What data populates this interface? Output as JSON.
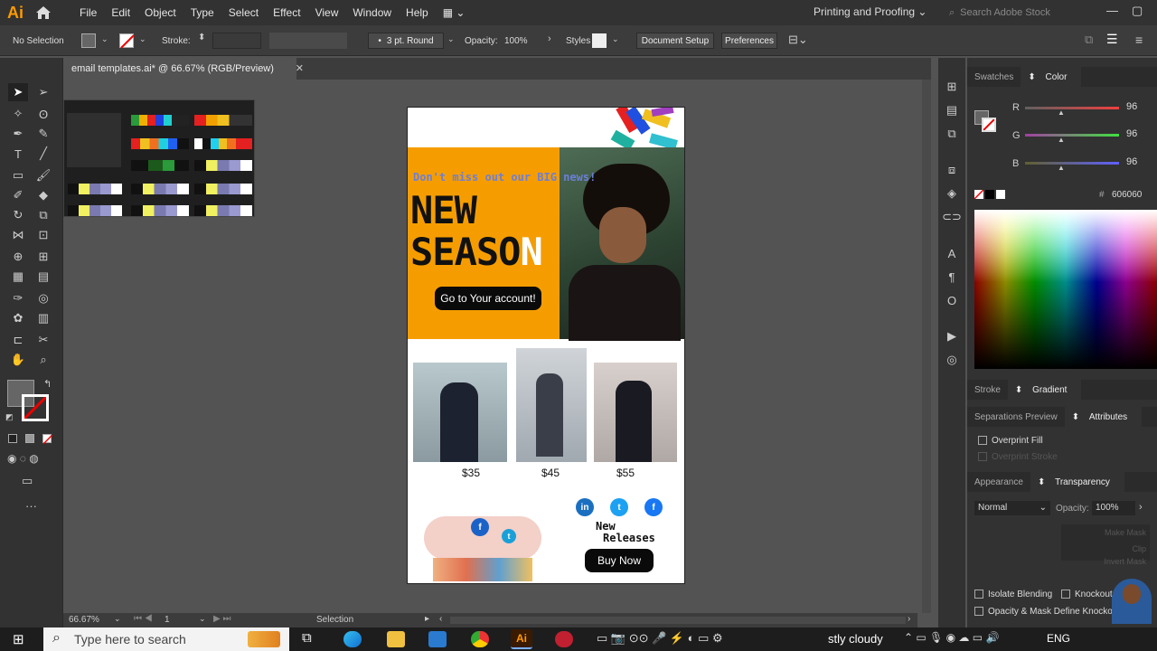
{
  "menubar": {
    "logo": "Ai",
    "items": [
      "File",
      "Edit",
      "Object",
      "Type",
      "Select",
      "Effect",
      "View",
      "Window",
      "Help"
    ],
    "workspace": "Printing and Proofing",
    "search_placeholder": "Search Adobe Stock"
  },
  "controlbar": {
    "selection": "No Selection",
    "stroke_label": "Stroke:",
    "brush": "3 pt. Round",
    "opacity_label": "Opacity:",
    "opacity_value": "100%",
    "styles_label": "Styles",
    "document_setup": "Document Setup",
    "preferences": "Preferences"
  },
  "document": {
    "tab_title": "email templates.ai* @ 66.67% (RGB/Preview)",
    "zoom": "66.67%",
    "artboard_number": "1",
    "status_tool": "Selection"
  },
  "artboard": {
    "headline_small": "Don't miss out our BIG news!",
    "title_line1": "NEW",
    "title_line2": "SEASO",
    "title_last_letter": "N",
    "cta": "Go to Your account!",
    "products": [
      {
        "price": "$35"
      },
      {
        "price": "$45"
      },
      {
        "price": "$55"
      }
    ],
    "social": {
      "linkedin": "in",
      "twitter": "t",
      "facebook": "f"
    },
    "new_releases_line1": "New",
    "new_releases_line2": "Releases",
    "buy_now": "Buy Now",
    "colors": {
      "hero": "#f59d00",
      "title": "#111111",
      "news": "#6c7fd8"
    }
  },
  "panels": {
    "swatches_tab": "Swatches",
    "color_tab": "Color",
    "r_label": "R",
    "r_value": "96",
    "g_label": "G",
    "g_value": "96",
    "b_label": "B",
    "b_value": "96",
    "hex": "606060",
    "stroke_tab": "Stroke",
    "gradient_tab": "Gradient",
    "separations_tab": "Separations Preview",
    "attributes_tab": "Attributes",
    "overprint_fill": "Overprint Fill",
    "overprint_stroke": "Overprint Stroke",
    "appearance_tab": "Appearance",
    "transparency_tab": "Transparency",
    "blend_mode": "Normal",
    "opacity_label": "Opacity:",
    "opacity_value": "100%",
    "make_mask": "Make Mask",
    "clip": "Clip",
    "invert_mask": "Invert Mask",
    "isolate_blending": "Isolate Blending",
    "knockout_group": "Knockout G",
    "opacity_mask": "Opacity & Mask Define Knockout Shape"
  },
  "taskbar": {
    "search_placeholder": "Type here to search",
    "weather": "stly cloudy",
    "language": "ENG"
  }
}
